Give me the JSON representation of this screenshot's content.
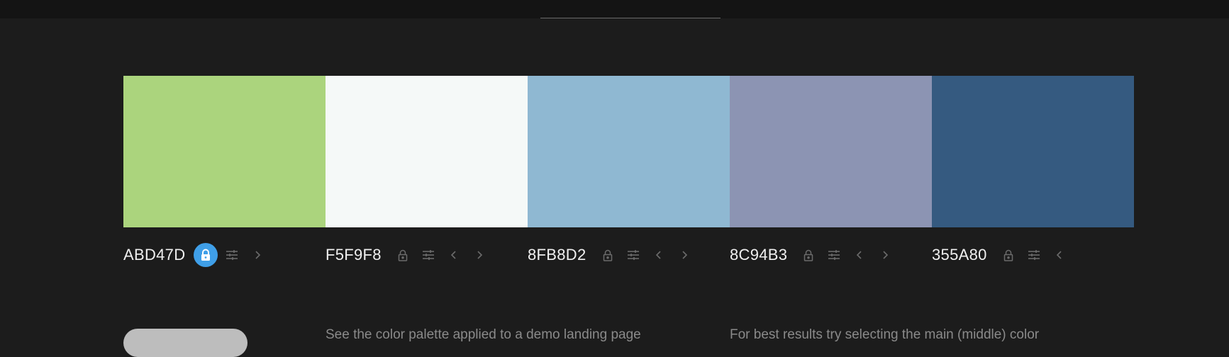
{
  "topbar": {
    "active_tab": ""
  },
  "palette": {
    "colors": [
      {
        "hex": "ABD47D",
        "color": "#ABD47D",
        "locked": true,
        "has_left": false,
        "has_right": true
      },
      {
        "hex": "F5F9F8",
        "color": "#F5F9F8",
        "locked": false,
        "has_left": true,
        "has_right": true
      },
      {
        "hex": "8FB8D2",
        "color": "#8FB8D2",
        "locked": false,
        "has_left": true,
        "has_right": true
      },
      {
        "hex": "8C94B3",
        "color": "#8C94B3",
        "locked": false,
        "has_left": true,
        "has_right": true
      },
      {
        "hex": "355A80",
        "color": "#355A80",
        "locked": false,
        "has_left": true,
        "has_right": false
      }
    ]
  },
  "icons": {
    "lock": "lock-icon",
    "adjust": "sliders-icon",
    "left": "chevron-left-icon",
    "right": "chevron-right-icon"
  },
  "footer": {
    "cta_label": "",
    "hint_one": "See the color palette applied to a demo landing page",
    "hint_two": "For best results try selecting the main (middle) color"
  },
  "accent_color": "#3F9FE8"
}
